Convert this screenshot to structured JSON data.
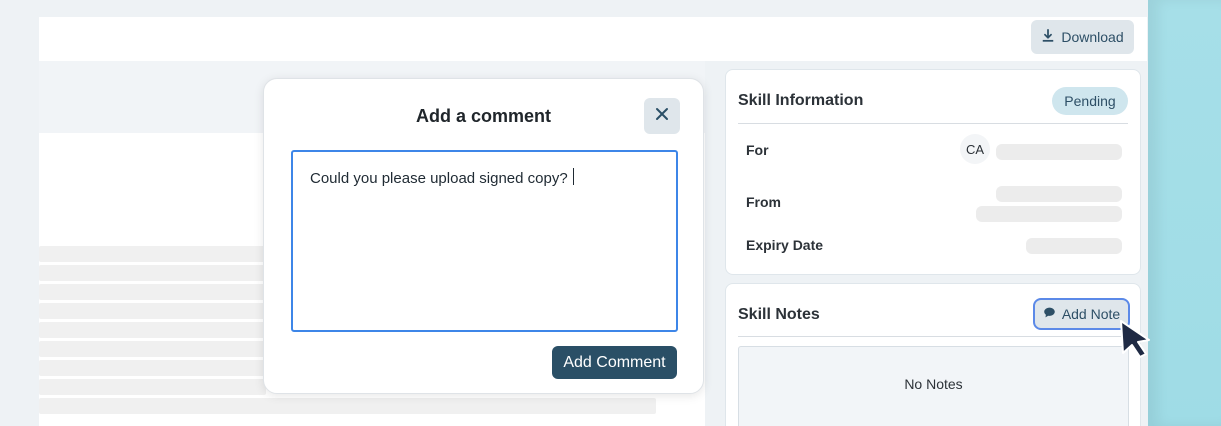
{
  "toolbar": {
    "download_label": "Download"
  },
  "modal": {
    "title": "Add a comment",
    "comment_value": "Could you please upload signed copy? ",
    "submit_label": "Add Comment",
    "close_icon": "close-icon"
  },
  "skill_information": {
    "title": "Skill Information",
    "status": "Pending",
    "fields": {
      "for_label": "For",
      "avatar_initials": "CA",
      "from_label": "From",
      "expiry_label": "Expiry Date"
    }
  },
  "skill_notes": {
    "title": "Skill Notes",
    "add_note_label": "Add Note",
    "empty_text": "No Notes"
  },
  "icons": {
    "download": "download-icon",
    "note": "comment-icon",
    "close": "close-icon",
    "cursor": "mouse-pointer-icon"
  },
  "colors": {
    "primary": "#2a4f66",
    "accent_blue": "#3d86e8",
    "badge_bg": "#cfe6ee",
    "button_bg": "#dfe6eb",
    "page_bg": "#eef2f5"
  }
}
